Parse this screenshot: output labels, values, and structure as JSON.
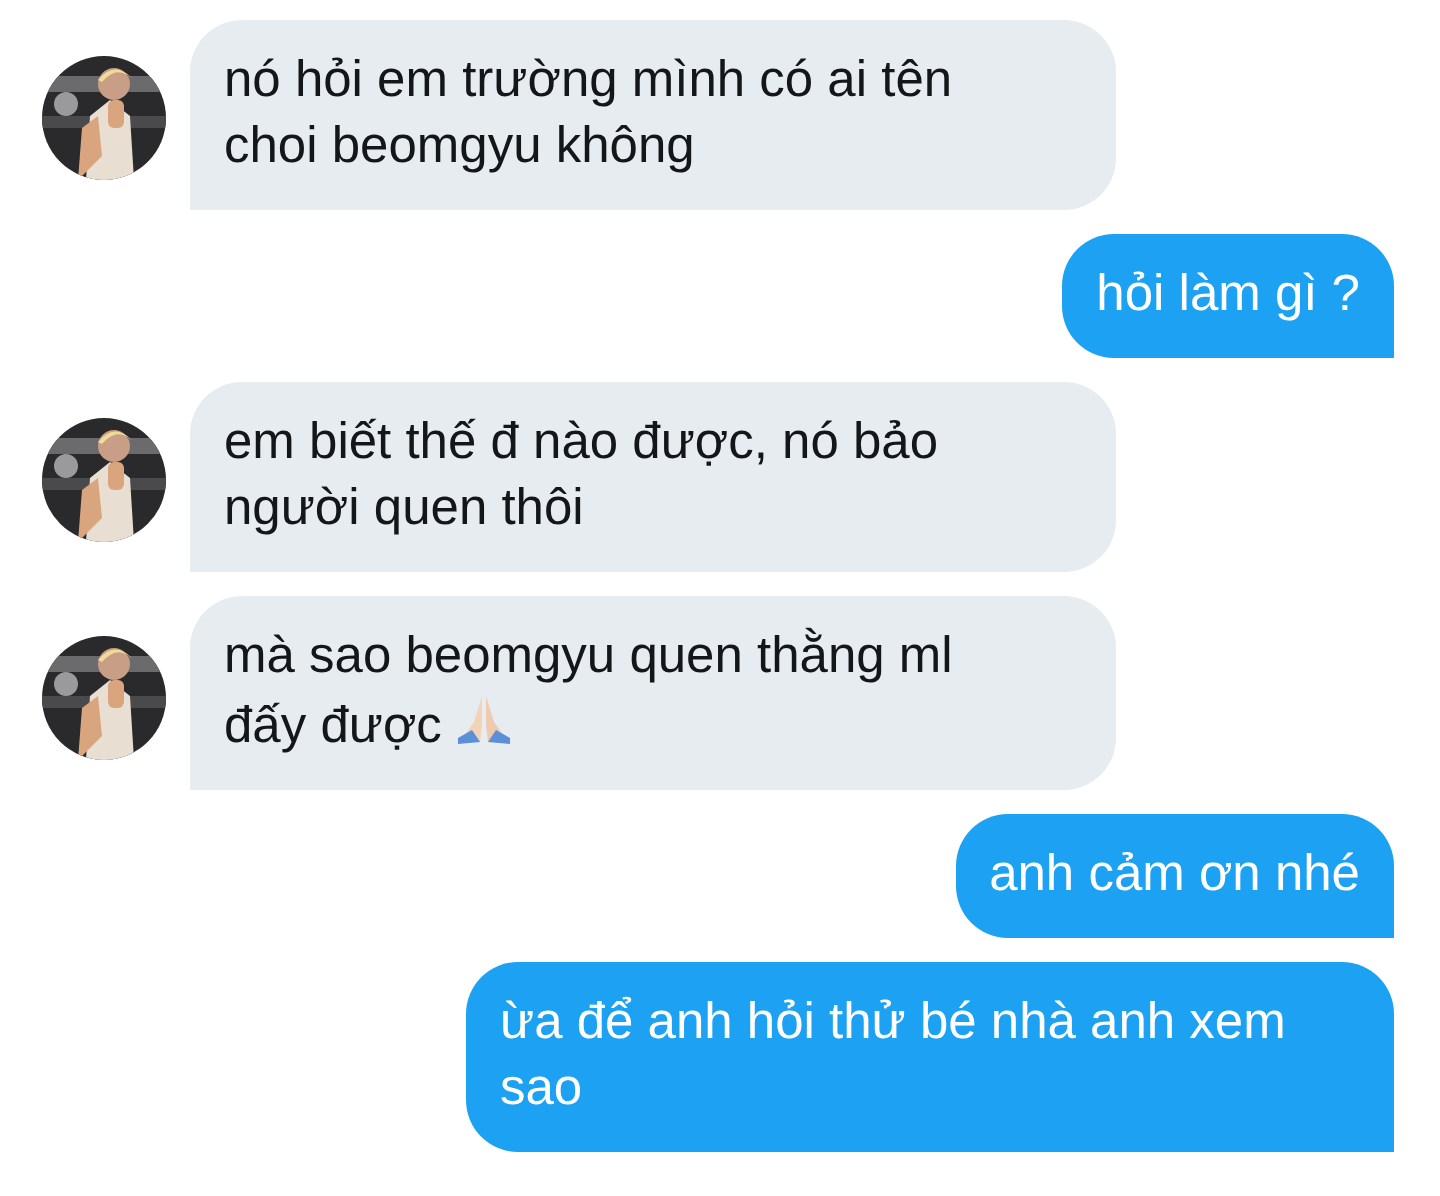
{
  "messages": [
    {
      "kind": "received",
      "text": "nó hỏi em trường mình có ai tên choi beomgyu không",
      "avatar": true,
      "trailing_icon": false
    },
    {
      "kind": "sent",
      "text": "hỏi làm gì ?",
      "avatar": false,
      "trailing_icon": false
    },
    {
      "kind": "received",
      "text": "em biết thế đ nào được, nó bảo người quen thôi",
      "avatar": true,
      "trailing_icon": false
    },
    {
      "kind": "received",
      "text": "mà sao beomgyu quen thằng ml đấy được",
      "avatar": true,
      "trailing_icon": true
    },
    {
      "kind": "sent",
      "text": "anh cảm ơn nhé",
      "avatar": false,
      "trailing_icon": false
    },
    {
      "kind": "sent",
      "text": "ừa để anh hỏi thử bé nhà anh xem sao",
      "avatar": false,
      "trailing_icon": false
    }
  ]
}
